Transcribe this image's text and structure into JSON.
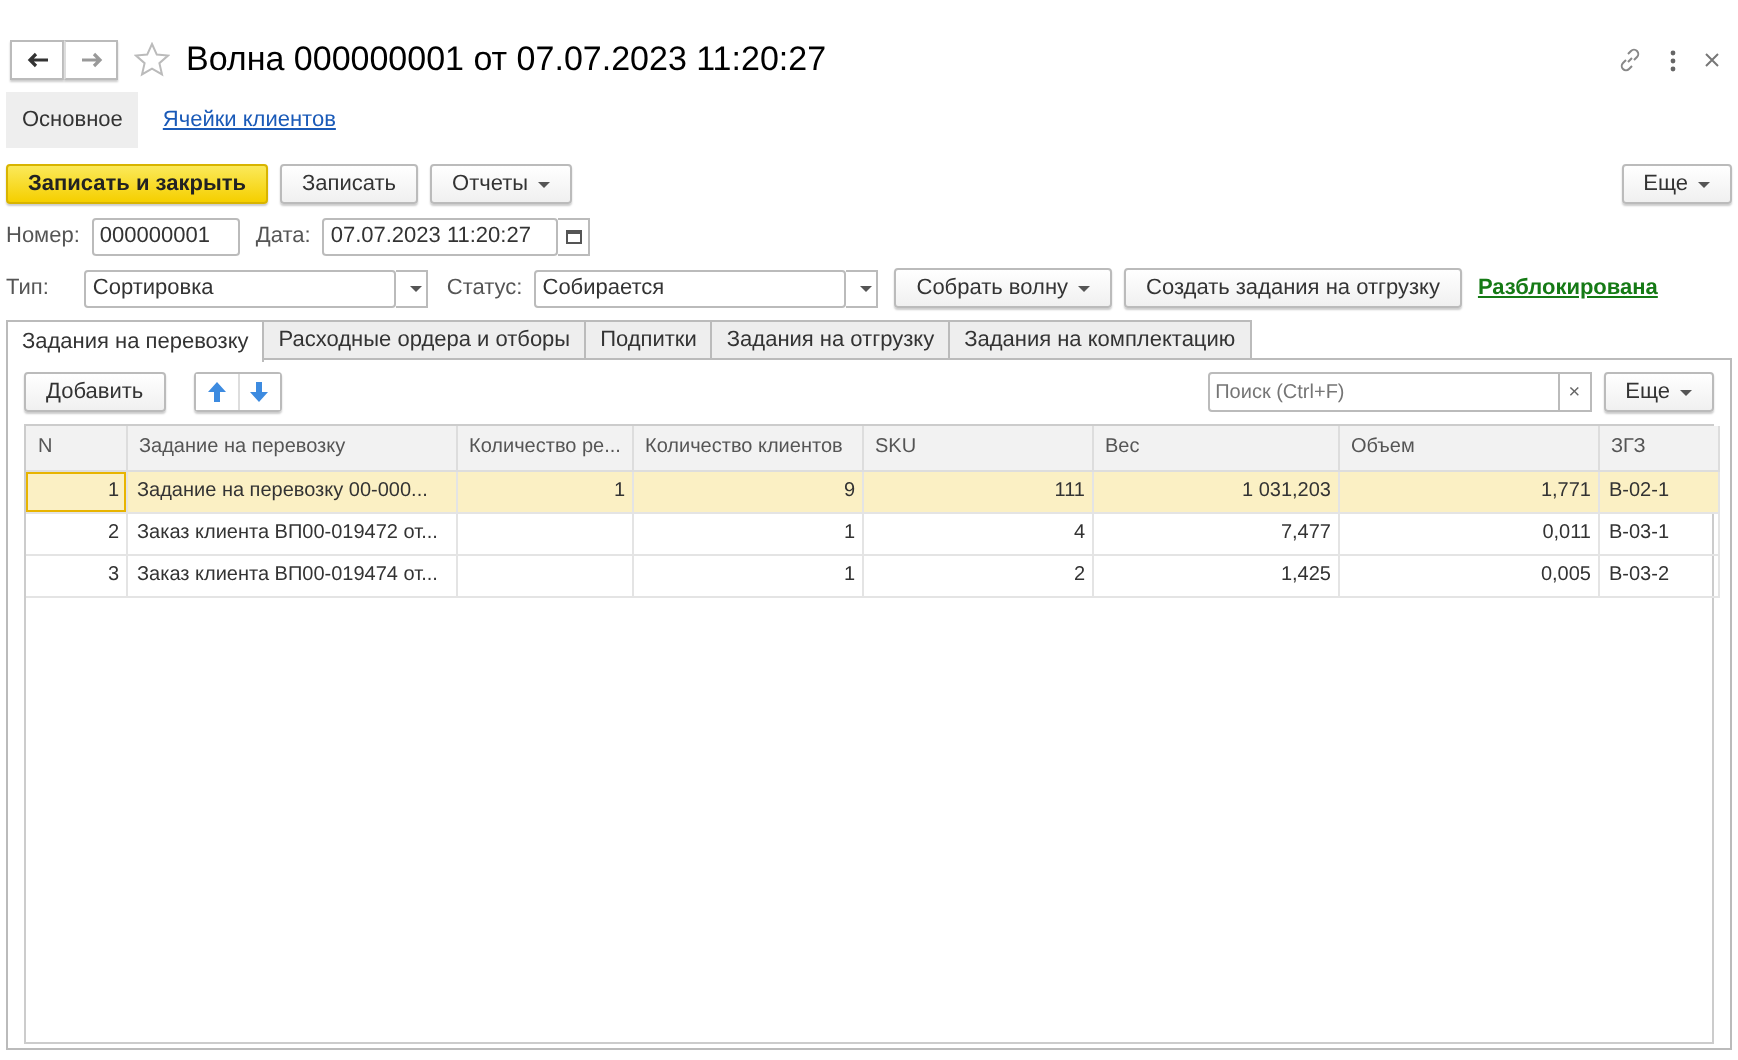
{
  "window": {
    "title": "Волна 000000001 от 07.07.2023 11:20:27",
    "favorite": false
  },
  "sections": [
    {
      "label": "Основное",
      "selected": true
    },
    {
      "label": "Ячейки клиентов",
      "selected": false
    }
  ],
  "toolbar": {
    "save_close": "Записать и закрыть",
    "save": "Записать",
    "reports": "Отчеты",
    "more": "Еще"
  },
  "number": {
    "label": "Номер:",
    "value": "000000001"
  },
  "date": {
    "label": "Дата:",
    "value": "07.07.2023 11:20:27"
  },
  "type": {
    "label": "Тип:",
    "value": "Сортировка"
  },
  "status": {
    "label": "Статус:",
    "value": "Собирается"
  },
  "actions": {
    "collect": "Собрать волну",
    "create": "Создать задания на отгрузку",
    "lock_state": "Разблокирована"
  },
  "tabs": [
    {
      "label": "Задания на перевозку",
      "selected": true
    },
    {
      "label": "Расходные ордера и отборы",
      "selected": false
    },
    {
      "label": "Подпитки",
      "selected": false
    },
    {
      "label": "Задания на отгрузку",
      "selected": false
    },
    {
      "label": "Задания на комплектацию",
      "selected": false
    }
  ],
  "table_toolbar": {
    "add": "Добавить",
    "search_placeholder": "Поиск (Ctrl+F)",
    "clear": "×",
    "more": "Еще"
  },
  "table": {
    "columns": [
      "N",
      "Задание на перевозку",
      "Количество ре...",
      "Количество клиентов",
      "SKU",
      "Вес",
      "Объем",
      "ЗГЗ"
    ],
    "rows": [
      {
        "cells": [
          "1",
          "Задание на перевозку 00-000...",
          "1",
          "9",
          "111",
          "1 031,203",
          "1,771",
          "В-02-1"
        ],
        "selected": true
      },
      {
        "cells": [
          "2",
          "Заказ клиента ВП00-019472 от...",
          "",
          "1",
          "4",
          "7,477",
          "0,011",
          "В-03-1"
        ],
        "selected": false
      },
      {
        "cells": [
          "3",
          "Заказ клиента ВП00-019474 от...",
          "",
          "1",
          "2",
          "1,425",
          "0,005",
          "В-03-2"
        ],
        "selected": false
      }
    ]
  }
}
